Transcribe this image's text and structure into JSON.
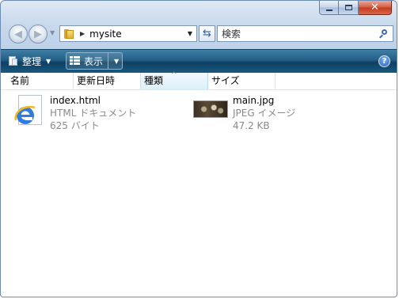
{
  "window": {
    "title_buttons": {
      "minimize": "minimize",
      "maximize": "maximize",
      "close": "✕"
    }
  },
  "navigation": {
    "back_icon": "back-arrow-icon",
    "forward_icon": "forward-arrow-icon",
    "address": {
      "folder_icon": "folder-icon",
      "crumb": "mysite"
    },
    "search": {
      "placeholder": "検索"
    }
  },
  "toolbar": {
    "organize_label": "整理",
    "views_label": "表示",
    "help": "?"
  },
  "columns": [
    "名前",
    "更新日時",
    "種類",
    "サイズ"
  ],
  "sorted_column": "種類",
  "files": [
    {
      "name": "index.html",
      "type": "HTML ドキュメント",
      "size": "625 バイト",
      "icon": "ie-html-icon"
    },
    {
      "name": "main.jpg",
      "type": "JPEG イメージ",
      "size": "47.2 KB",
      "icon": "jpeg-thumbnail"
    }
  ],
  "colors": {
    "command_bar": "#1a587f",
    "chrome": "#c9d9ec",
    "close_button": "#c23a1c",
    "secondary_text": "#8a8a8a"
  }
}
